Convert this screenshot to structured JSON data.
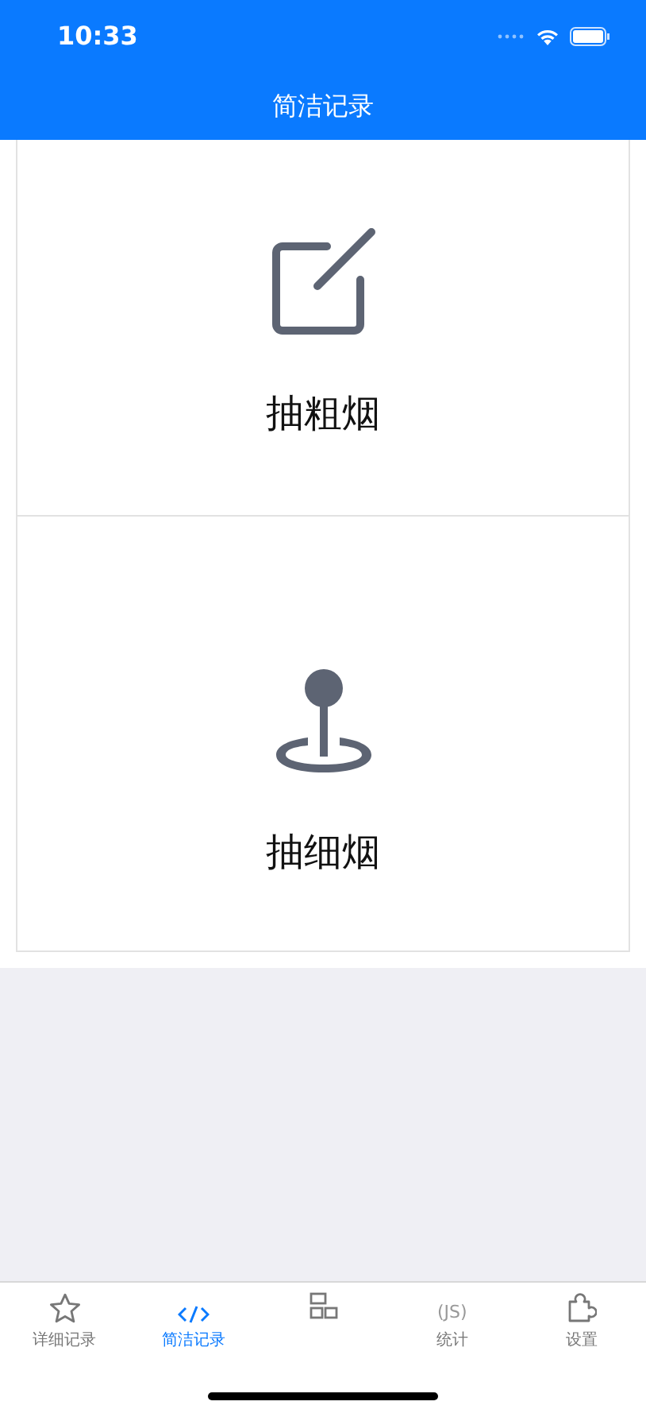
{
  "status_bar": {
    "time": "10:33"
  },
  "header": {
    "title": "简洁记录"
  },
  "actions": [
    {
      "kind": "edit",
      "label": "抽粗烟"
    },
    {
      "kind": "pin",
      "label": "抽细烟"
    }
  ],
  "tabs": [
    {
      "kind": "star",
      "label": "详细记录",
      "selected": false
    },
    {
      "kind": "code",
      "label": "简洁记录",
      "selected": true
    },
    {
      "kind": "grid",
      "selected": false
    },
    {
      "kind": "js",
      "glyph": "(JS)",
      "label": "统计",
      "selected": false
    },
    {
      "kind": "puzzle",
      "label": "设置",
      "selected": false
    }
  ]
}
